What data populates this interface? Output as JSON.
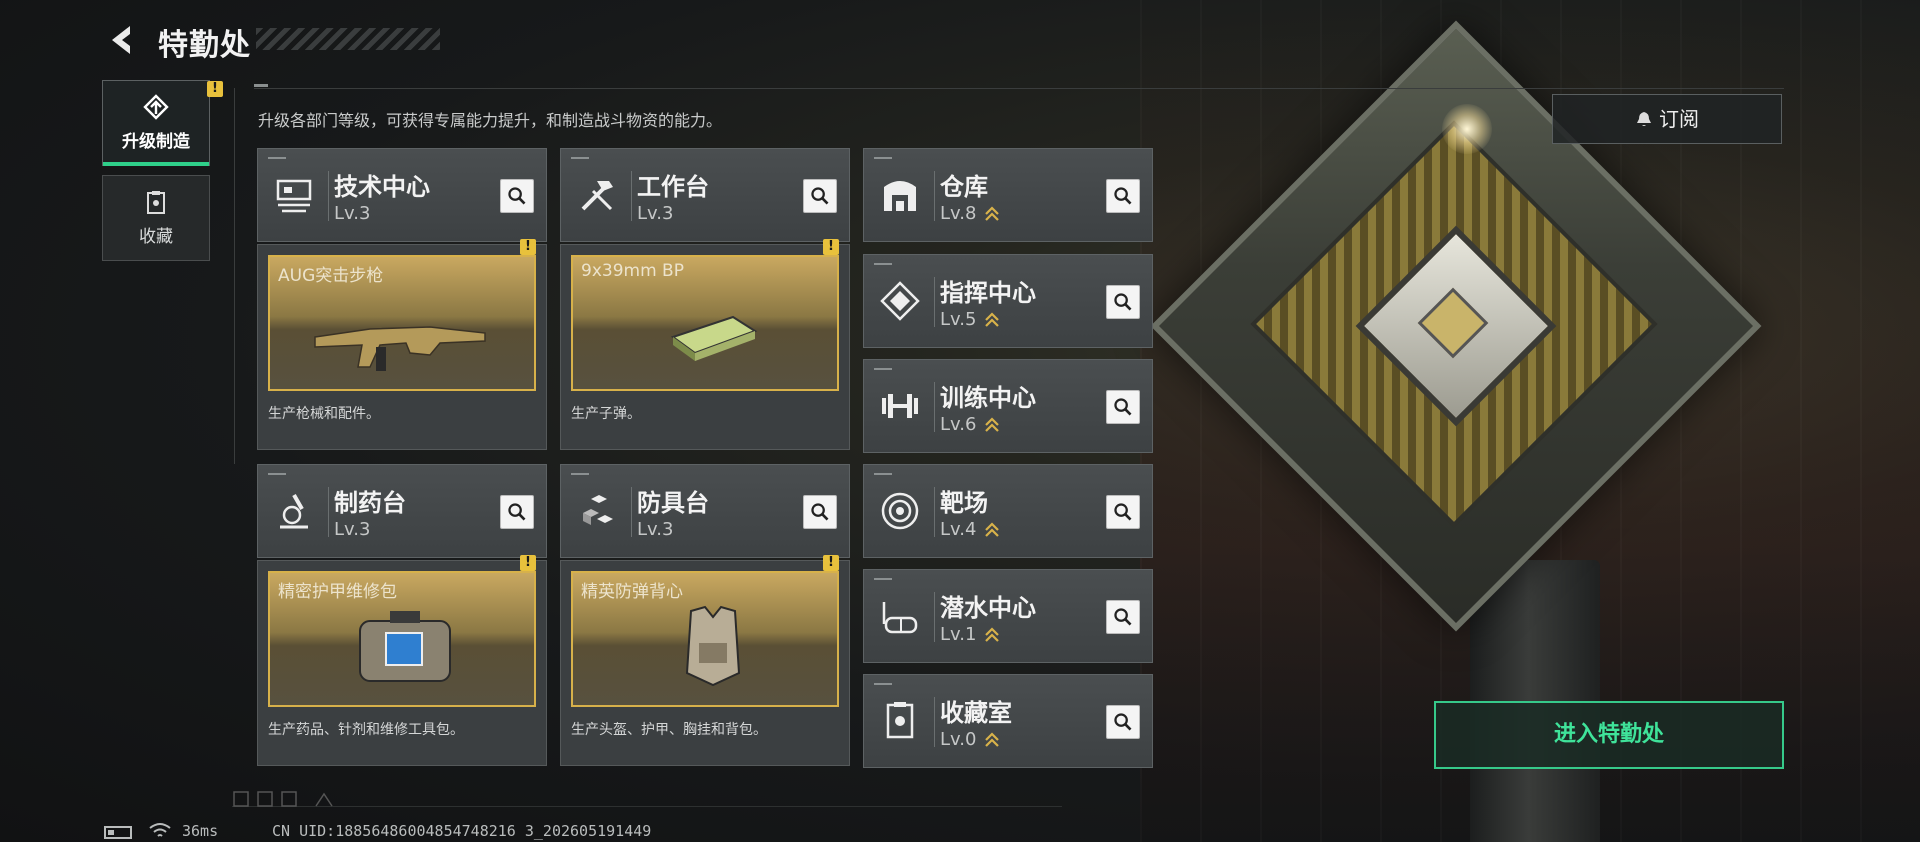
{
  "header": {
    "title": "特勤处",
    "description": "升级各部门等级，可获得专属能力提升，和制造战斗物资的能力。"
  },
  "side_tabs": [
    {
      "label": "升级制造",
      "active": true,
      "warn": "!"
    },
    {
      "label": "收藏",
      "active": false
    }
  ],
  "departments": [
    {
      "name": "技术中心",
      "level": "Lv.3",
      "icon": "tech-center-icon"
    },
    {
      "name": "工作台",
      "level": "Lv.3",
      "icon": "workbench-icon"
    },
    {
      "name": "仓库",
      "level": "Lv.8",
      "icon": "warehouse-icon",
      "upgrade": true
    },
    {
      "name": "指挥中心",
      "level": "Lv.5",
      "icon": "command-center-icon",
      "upgrade": true
    },
    {
      "name": "训练中心",
      "level": "Lv.6",
      "icon": "training-center-icon",
      "upgrade": true
    },
    {
      "name": "制药台",
      "level": "Lv.3",
      "icon": "pharmacy-icon"
    },
    {
      "name": "防具台",
      "level": "Lv.3",
      "icon": "armor-bench-icon"
    },
    {
      "name": "靶场",
      "level": "Lv.4",
      "icon": "shooting-range-icon",
      "upgrade": true
    },
    {
      "name": "潜水中心",
      "level": "Lv.1",
      "icon": "diving-center-icon",
      "upgrade": true
    },
    {
      "name": "收藏室",
      "level": "Lv.0",
      "icon": "collection-room-icon",
      "upgrade": true
    }
  ],
  "productions": [
    {
      "item": "AUG突击步枪",
      "desc": "生产枪械和配件。",
      "warn": "!"
    },
    {
      "item": "9x39mm BP",
      "desc": "生产子弹。",
      "warn": "!"
    },
    {
      "item": "精密护甲维修包",
      "desc": "生产药品、针剂和维修工具包。",
      "warn": "!"
    },
    {
      "item": "精英防弹背心",
      "desc": "生产头盔、护甲、胸挂和背包。",
      "warn": "!"
    }
  ],
  "buttons": {
    "subscribe": "订阅",
    "enter": "进入特勤处"
  },
  "status": {
    "ping": "36ms",
    "uid": "CN UID:18856486004854748216 3_202605191449"
  },
  "colors": {
    "accent": "#2fd08a",
    "warning": "#e8c13c",
    "gold_frame": "#d7b14a"
  }
}
